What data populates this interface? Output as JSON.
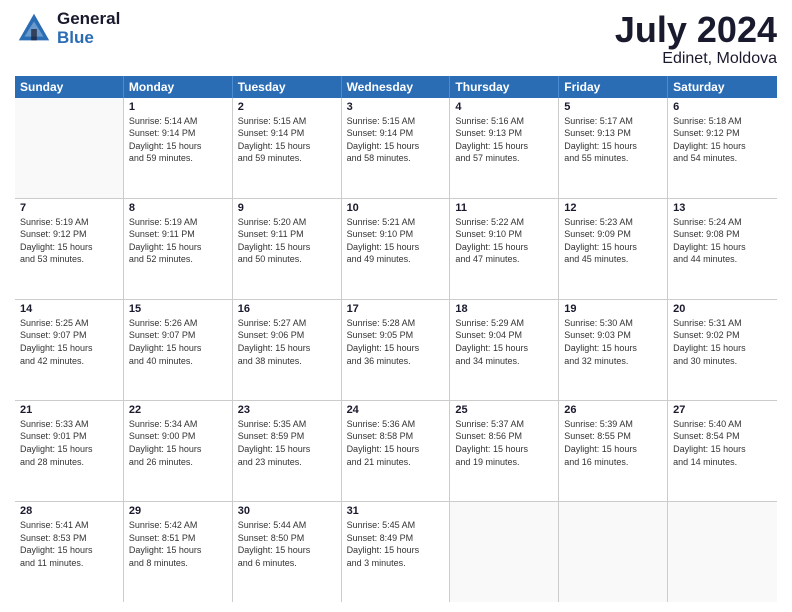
{
  "header": {
    "logo_general": "General",
    "logo_blue": "Blue",
    "month_year": "July 2024",
    "location": "Edinet, Moldova"
  },
  "calendar": {
    "days_of_week": [
      "Sunday",
      "Monday",
      "Tuesday",
      "Wednesday",
      "Thursday",
      "Friday",
      "Saturday"
    ],
    "rows": [
      [
        {
          "day": "",
          "info": ""
        },
        {
          "day": "1",
          "info": "Sunrise: 5:14 AM\nSunset: 9:14 PM\nDaylight: 15 hours\nand 59 minutes."
        },
        {
          "day": "2",
          "info": "Sunrise: 5:15 AM\nSunset: 9:14 PM\nDaylight: 15 hours\nand 59 minutes."
        },
        {
          "day": "3",
          "info": "Sunrise: 5:15 AM\nSunset: 9:14 PM\nDaylight: 15 hours\nand 58 minutes."
        },
        {
          "day": "4",
          "info": "Sunrise: 5:16 AM\nSunset: 9:13 PM\nDaylight: 15 hours\nand 57 minutes."
        },
        {
          "day": "5",
          "info": "Sunrise: 5:17 AM\nSunset: 9:13 PM\nDaylight: 15 hours\nand 55 minutes."
        },
        {
          "day": "6",
          "info": "Sunrise: 5:18 AM\nSunset: 9:12 PM\nDaylight: 15 hours\nand 54 minutes."
        }
      ],
      [
        {
          "day": "7",
          "info": "Sunrise: 5:19 AM\nSunset: 9:12 PM\nDaylight: 15 hours\nand 53 minutes."
        },
        {
          "day": "8",
          "info": "Sunrise: 5:19 AM\nSunset: 9:11 PM\nDaylight: 15 hours\nand 52 minutes."
        },
        {
          "day": "9",
          "info": "Sunrise: 5:20 AM\nSunset: 9:11 PM\nDaylight: 15 hours\nand 50 minutes."
        },
        {
          "day": "10",
          "info": "Sunrise: 5:21 AM\nSunset: 9:10 PM\nDaylight: 15 hours\nand 49 minutes."
        },
        {
          "day": "11",
          "info": "Sunrise: 5:22 AM\nSunset: 9:10 PM\nDaylight: 15 hours\nand 47 minutes."
        },
        {
          "day": "12",
          "info": "Sunrise: 5:23 AM\nSunset: 9:09 PM\nDaylight: 15 hours\nand 45 minutes."
        },
        {
          "day": "13",
          "info": "Sunrise: 5:24 AM\nSunset: 9:08 PM\nDaylight: 15 hours\nand 44 minutes."
        }
      ],
      [
        {
          "day": "14",
          "info": "Sunrise: 5:25 AM\nSunset: 9:07 PM\nDaylight: 15 hours\nand 42 minutes."
        },
        {
          "day": "15",
          "info": "Sunrise: 5:26 AM\nSunset: 9:07 PM\nDaylight: 15 hours\nand 40 minutes."
        },
        {
          "day": "16",
          "info": "Sunrise: 5:27 AM\nSunset: 9:06 PM\nDaylight: 15 hours\nand 38 minutes."
        },
        {
          "day": "17",
          "info": "Sunrise: 5:28 AM\nSunset: 9:05 PM\nDaylight: 15 hours\nand 36 minutes."
        },
        {
          "day": "18",
          "info": "Sunrise: 5:29 AM\nSunset: 9:04 PM\nDaylight: 15 hours\nand 34 minutes."
        },
        {
          "day": "19",
          "info": "Sunrise: 5:30 AM\nSunset: 9:03 PM\nDaylight: 15 hours\nand 32 minutes."
        },
        {
          "day": "20",
          "info": "Sunrise: 5:31 AM\nSunset: 9:02 PM\nDaylight: 15 hours\nand 30 minutes."
        }
      ],
      [
        {
          "day": "21",
          "info": "Sunrise: 5:33 AM\nSunset: 9:01 PM\nDaylight: 15 hours\nand 28 minutes."
        },
        {
          "day": "22",
          "info": "Sunrise: 5:34 AM\nSunset: 9:00 PM\nDaylight: 15 hours\nand 26 minutes."
        },
        {
          "day": "23",
          "info": "Sunrise: 5:35 AM\nSunset: 8:59 PM\nDaylight: 15 hours\nand 23 minutes."
        },
        {
          "day": "24",
          "info": "Sunrise: 5:36 AM\nSunset: 8:58 PM\nDaylight: 15 hours\nand 21 minutes."
        },
        {
          "day": "25",
          "info": "Sunrise: 5:37 AM\nSunset: 8:56 PM\nDaylight: 15 hours\nand 19 minutes."
        },
        {
          "day": "26",
          "info": "Sunrise: 5:39 AM\nSunset: 8:55 PM\nDaylight: 15 hours\nand 16 minutes."
        },
        {
          "day": "27",
          "info": "Sunrise: 5:40 AM\nSunset: 8:54 PM\nDaylight: 15 hours\nand 14 minutes."
        }
      ],
      [
        {
          "day": "28",
          "info": "Sunrise: 5:41 AM\nSunset: 8:53 PM\nDaylight: 15 hours\nand 11 minutes."
        },
        {
          "day": "29",
          "info": "Sunrise: 5:42 AM\nSunset: 8:51 PM\nDaylight: 15 hours\nand 8 minutes."
        },
        {
          "day": "30",
          "info": "Sunrise: 5:44 AM\nSunset: 8:50 PM\nDaylight: 15 hours\nand 6 minutes."
        },
        {
          "day": "31",
          "info": "Sunrise: 5:45 AM\nSunset: 8:49 PM\nDaylight: 15 hours\nand 3 minutes."
        },
        {
          "day": "",
          "info": ""
        },
        {
          "day": "",
          "info": ""
        },
        {
          "day": "",
          "info": ""
        }
      ]
    ]
  }
}
